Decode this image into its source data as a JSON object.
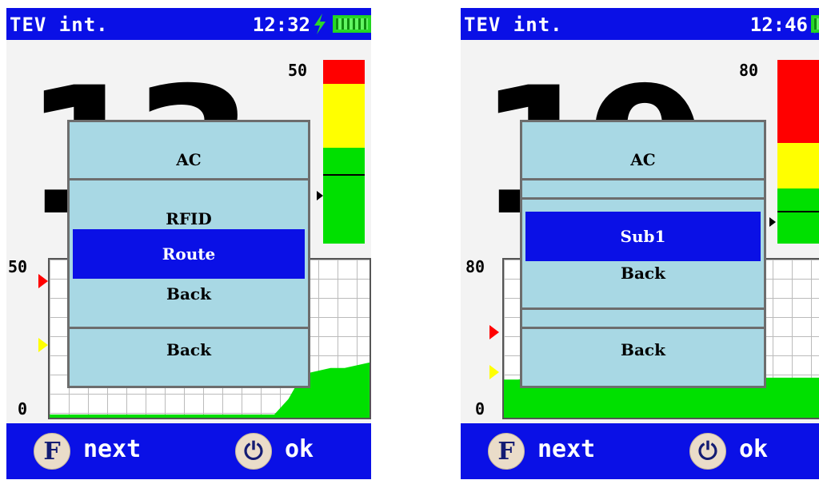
{
  "screens": [
    {
      "status": {
        "title": "TEV int.",
        "time": "12:32"
      },
      "big_value": "13",
      "level": {
        "scale_max": "50",
        "red_fraction": 0.13,
        "yellow_fraction": 0.35,
        "pointer_fraction": 0.62
      },
      "graph": {
        "y_max": "50",
        "y_min": "0",
        "data": [
          0,
          0,
          0,
          0,
          0,
          0,
          0,
          0,
          0,
          0,
          0,
          0,
          0,
          0,
          0,
          0,
          0,
          5,
          13,
          14,
          15,
          15,
          16,
          17
        ]
      },
      "menu": {
        "header": "AC",
        "items": [
          {
            "label": "RFID"
          },
          {
            "label": "Route",
            "selected": true
          },
          {
            "label": "Back"
          }
        ],
        "footer": "Back"
      },
      "footer": {
        "f_key": "F",
        "next_label": "next",
        "power_key": "⏻",
        "ok_label": "ok"
      }
    },
    {
      "status": {
        "title": "TEV int.",
        "time": "12:46"
      },
      "big_value": "19",
      "level": {
        "scale_max": "80",
        "red_fraction": 0.45,
        "yellow_fraction": 0.25,
        "pointer_fraction": 0.82
      },
      "graph": {
        "y_max": "80",
        "y_min": "0",
        "data": [
          18,
          18,
          19,
          19,
          18,
          19,
          19,
          19,
          18,
          19,
          19,
          19,
          18,
          19,
          19,
          19,
          18,
          19,
          19,
          19,
          19,
          19,
          19,
          19
        ]
      },
      "menu": {
        "header": "AC",
        "items": [
          {
            "label": "Sub1",
            "selected": true
          },
          {
            "label": "Back"
          }
        ],
        "footer": "Back"
      },
      "footer": {
        "f_key": "F",
        "next_label": "next",
        "power_key": "⏻",
        "ok_label": "ok"
      }
    }
  ],
  "colors": {
    "bar_blue": "#0a10e6",
    "menu_bg": "#a8d8e4",
    "graph_fill": "#00e000",
    "alarm_red": "#ff0000",
    "warn_yellow": "#ffff00"
  }
}
